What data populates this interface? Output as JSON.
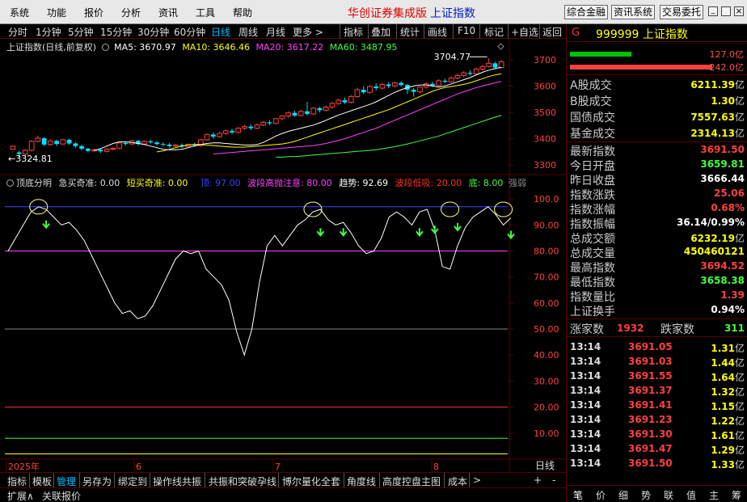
{
  "menu": {
    "items": [
      "系统",
      "功能",
      "报价",
      "分析",
      "资讯",
      "工具",
      "帮助"
    ],
    "title_brand": "华创证券集成版",
    "title_index": "上证指数",
    "right_buttons": [
      "综合金融",
      "资讯系统",
      "交易委托"
    ]
  },
  "toolbar": {
    "periods": [
      "分时",
      "1分钟",
      "5分钟",
      "15分钟",
      "30分钟",
      "60分钟",
      "日线",
      "周线",
      "月线",
      "更多 >"
    ],
    "active": "日线",
    "tools": [
      "指标",
      "叠加",
      "统计",
      "画线",
      "F10",
      "标记",
      "+自选",
      "返回"
    ]
  },
  "main_chart": {
    "title": "上证指数(日线,前复权)",
    "ma": [
      {
        "label": "MA5: 3670.97",
        "color": "#ffffff"
      },
      {
        "label": "MA10: 3646.46",
        "color": "#ffff00"
      },
      {
        "label": "MA20: 3617.22",
        "color": "#ff40ff"
      },
      {
        "label": "MA60: 3487.95",
        "color": "#40ff40"
      }
    ],
    "high_label": "3704.77",
    "low_label": "3324.81",
    "y_ticks": [
      "3700",
      "3600",
      "3500",
      "3400",
      "3300"
    ]
  },
  "osc_chart": {
    "name": "顶底分明",
    "items": [
      {
        "label": "急买奇准: 0.00",
        "color": "#dddddd"
      },
      {
        "label": "短买奇准: 0.00",
        "color": "#ffff00"
      },
      {
        "label": "顶: 97.00",
        "color": "#4040ff"
      },
      {
        "label": "波段高抛注意: 80.00",
        "color": "#ff40ff"
      },
      {
        "label": "趋势: 92.69",
        "color": "#ffffff"
      },
      {
        "label": "波段低吸: 20.00",
        "color": "#ff3030"
      },
      {
        "label": "底: 8.00",
        "color": "#40ff40"
      },
      {
        "label": "强弱",
        "color": "#888888"
      }
    ],
    "y_ticks": [
      "100.0",
      "90.00",
      "80.00",
      "70.00",
      "60.00",
      "50.00",
      "40.00",
      "30.00",
      "20.00",
      "10.00"
    ]
  },
  "x_axis": {
    "labels": [
      "2025年",
      "6",
      "7",
      "8"
    ],
    "period": "日线"
  },
  "chart_data": {
    "type": "line",
    "main": {
      "ylim": [
        3270,
        3730
      ],
      "candles": [
        [
          3360,
          3372,
          3352,
          3348
        ],
        [
          3348,
          3342,
          3354,
          3330
        ],
        [
          3342,
          3356,
          3360,
          3336
        ],
        [
          3356,
          3390,
          3395,
          3352
        ],
        [
          3390,
          3402,
          3412,
          3386
        ],
        [
          3402,
          3378,
          3406,
          3372
        ],
        [
          3378,
          3392,
          3398,
          3374
        ],
        [
          3392,
          3380,
          3396,
          3372
        ],
        [
          3380,
          3396,
          3400,
          3376
        ],
        [
          3396,
          3382,
          3400,
          3376
        ],
        [
          3382,
          3372,
          3388,
          3366
        ],
        [
          3372,
          3362,
          3378,
          3356
        ],
        [
          3362,
          3354,
          3366,
          3348
        ],
        [
          3354,
          3358,
          3362,
          3350
        ],
        [
          3358,
          3352,
          3362,
          3346
        ],
        [
          3352,
          3360,
          3364,
          3348
        ],
        [
          3360,
          3364,
          3368,
          3356
        ],
        [
          3364,
          3384,
          3388,
          3360
        ],
        [
          3384,
          3380,
          3390,
          3374
        ],
        [
          3380,
          3392,
          3396,
          3376
        ],
        [
          3392,
          3380,
          3396,
          3374
        ],
        [
          3380,
          3390,
          3394,
          3376
        ],
        [
          3390,
          3386,
          3396,
          3382
        ],
        [
          3386,
          3380,
          3390,
          3374
        ],
        [
          3380,
          3378,
          3386,
          3372
        ],
        [
          3378,
          3372,
          3384,
          3366
        ],
        [
          3372,
          3376,
          3380,
          3368
        ],
        [
          3376,
          3370,
          3382,
          3364
        ],
        [
          3370,
          3378,
          3382,
          3366
        ],
        [
          3378,
          3374,
          3384,
          3370
        ],
        [
          3374,
          3396,
          3400,
          3370
        ],
        [
          3396,
          3416,
          3420,
          3392
        ],
        [
          3416,
          3408,
          3424,
          3400
        ],
        [
          3408,
          3420,
          3426,
          3404
        ],
        [
          3420,
          3430,
          3436,
          3414
        ],
        [
          3430,
          3424,
          3438,
          3418
        ],
        [
          3424,
          3440,
          3444,
          3420
        ],
        [
          3440,
          3446,
          3452,
          3434
        ],
        [
          3446,
          3440,
          3454,
          3432
        ],
        [
          3440,
          3452,
          3458,
          3436
        ],
        [
          3452,
          3462,
          3468,
          3448
        ],
        [
          3462,
          3458,
          3470,
          3452
        ],
        [
          3458,
          3476,
          3480,
          3454
        ],
        [
          3476,
          3486,
          3490,
          3470
        ],
        [
          3486,
          3498,
          3504,
          3480
        ],
        [
          3498,
          3488,
          3506,
          3484
        ],
        [
          3488,
          3504,
          3510,
          3484
        ],
        [
          3504,
          3494,
          3540,
          3490
        ],
        [
          3494,
          3516,
          3520,
          3490
        ],
        [
          3516,
          3508,
          3522,
          3500
        ],
        [
          3508,
          3520,
          3526,
          3504
        ],
        [
          3520,
          3534,
          3540,
          3514
        ],
        [
          3534,
          3546,
          3552,
          3528
        ],
        [
          3546,
          3538,
          3556,
          3532
        ],
        [
          3538,
          3560,
          3566,
          3534
        ],
        [
          3560,
          3586,
          3594,
          3556
        ],
        [
          3586,
          3576,
          3600,
          3570
        ],
        [
          3576,
          3598,
          3604,
          3570
        ],
        [
          3598,
          3592,
          3610,
          3584
        ],
        [
          3592,
          3606,
          3612,
          3586
        ],
        [
          3606,
          3600,
          3614,
          3592
        ],
        [
          3600,
          3612,
          3616,
          3594
        ],
        [
          3612,
          3604,
          3618,
          3598
        ],
        [
          3604,
          3586,
          3608,
          3570
        ],
        [
          3586,
          3578,
          3592,
          3560
        ],
        [
          3578,
          3596,
          3600,
          3572
        ],
        [
          3596,
          3608,
          3614,
          3590
        ],
        [
          3608,
          3602,
          3616,
          3596
        ],
        [
          3602,
          3620,
          3626,
          3598
        ],
        [
          3620,
          3616,
          3628,
          3610
        ],
        [
          3616,
          3630,
          3636,
          3612
        ],
        [
          3630,
          3640,
          3648,
          3626
        ],
        [
          3640,
          3650,
          3656,
          3634
        ],
        [
          3650,
          3646,
          3660,
          3640
        ],
        [
          3646,
          3664,
          3670,
          3642
        ],
        [
          3664,
          3674,
          3680,
          3658
        ],
        [
          3674,
          3686,
          3704.77,
          3670
        ],
        [
          3686,
          3670,
          3692,
          3664
        ],
        [
          3670,
          3692,
          3698,
          3666
        ]
      ],
      "ma5": [
        3356,
        3362,
        3372,
        3382,
        3388,
        3388,
        3386,
        3382,
        3378,
        3372,
        3366,
        3360,
        3358,
        3358,
        3360,
        3366,
        3372,
        3378,
        3382,
        3384,
        3384,
        3382,
        3380,
        3378,
        3376,
        3376,
        3378,
        3386,
        3398,
        3410,
        3420,
        3428,
        3434,
        3440,
        3446,
        3452,
        3460,
        3470,
        3480,
        3490,
        3498,
        3506,
        3514,
        3522,
        3530,
        3540,
        3552,
        3564,
        3576,
        3586,
        3594,
        3600,
        3604,
        3604,
        3600,
        3596,
        3600,
        3608,
        3616,
        3624,
        3632,
        3642,
        3652,
        3660,
        3666,
        3671
      ],
      "ma10": [
        3350,
        3354,
        3360,
        3366,
        3372,
        3376,
        3378,
        3378,
        3376,
        3374,
        3372,
        3370,
        3368,
        3368,
        3368,
        3370,
        3372,
        3374,
        3376,
        3378,
        3380,
        3384,
        3390,
        3398,
        3406,
        3414,
        3422,
        3430,
        3438,
        3446,
        3454,
        3462,
        3470,
        3478,
        3486,
        3494,
        3502,
        3510,
        3520,
        3530,
        3540,
        3550,
        3560,
        3570,
        3580,
        3588,
        3594,
        3598,
        3602,
        3606,
        3612,
        3620,
        3628,
        3636,
        3642,
        3646.46
      ],
      "ma20": [
        3342,
        3344,
        3346,
        3348,
        3350,
        3352,
        3354,
        3356,
        3358,
        3360,
        3362,
        3364,
        3366,
        3368,
        3370,
        3372,
        3374,
        3378,
        3382,
        3388,
        3394,
        3400,
        3408,
        3416,
        3424,
        3432,
        3440,
        3450,
        3460,
        3470,
        3480,
        3490,
        3500,
        3510,
        3520,
        3530,
        3540,
        3550,
        3560,
        3570,
        3578,
        3586,
        3594,
        3600,
        3606,
        3612,
        3617.22
      ],
      "ma60": [
        3330,
        3330,
        3332,
        3332,
        3334,
        3336,
        3338,
        3340,
        3342,
        3344,
        3346,
        3348,
        3350,
        3352,
        3354,
        3356,
        3358,
        3362,
        3366,
        3370,
        3375,
        3380,
        3386,
        3392,
        3398,
        3404,
        3410,
        3418,
        3426,
        3434,
        3442,
        3450,
        3458,
        3466,
        3474,
        3482,
        3487.95
      ]
    },
    "osc": {
      "ylim": [
        0,
        105
      ],
      "trend": [
        80,
        85,
        90,
        95,
        97,
        96,
        93,
        90,
        91,
        88,
        84,
        78,
        72,
        66,
        60,
        56,
        57,
        54,
        55,
        59,
        65,
        71,
        77,
        80,
        79,
        80,
        73,
        70,
        67,
        61,
        49,
        40,
        50,
        68,
        82,
        86,
        82,
        86,
        90,
        92,
        95,
        96,
        92,
        90,
        91,
        87,
        82,
        79,
        80,
        85,
        93,
        95,
        93,
        90,
        95,
        96,
        88,
        74,
        73,
        82,
        89,
        93,
        95,
        97,
        94,
        90,
        92.69
      ],
      "markers": [
        {
          "x": 4,
          "y": 97,
          "type": "circle"
        },
        {
          "x": 5,
          "y": 93,
          "type": "arrow"
        },
        {
          "x": 40,
          "y": 96,
          "type": "circle"
        },
        {
          "x": 41,
          "y": 90,
          "type": "arrow"
        },
        {
          "x": 44,
          "y": 90,
          "type": "arrow"
        },
        {
          "x": 54,
          "y": 90,
          "type": "arrow"
        },
        {
          "x": 56,
          "y": 91,
          "type": "arrow"
        },
        {
          "x": 58,
          "y": 96,
          "type": "circle"
        },
        {
          "x": 59,
          "y": 92,
          "type": "arrow"
        },
        {
          "x": 65,
          "y": 96,
          "type": "circle"
        },
        {
          "x": 66,
          "y": 89,
          "type": "arrow"
        }
      ],
      "levels": [
        {
          "name": "顶",
          "value": 97,
          "color": "#4040ff"
        },
        {
          "name": "波段高抛注意",
          "value": 80,
          "color": "#ff40ff"
        },
        {
          "name": "中轴",
          "value": 50,
          "color": "#888888"
        },
        {
          "name": "波段低吸",
          "value": 20,
          "color": "#ff3030"
        },
        {
          "name": "底",
          "value": 8,
          "color": "#40ff40"
        },
        {
          "name": "零轴",
          "value": 2,
          "color": "#ffff00"
        }
      ]
    }
  },
  "quote_panel": {
    "flag": "G",
    "code": "999999",
    "name": "上证指数",
    "bar_up": "127.0亿",
    "bar_down": "242.0亿",
    "rows": [
      {
        "label": "A股成交",
        "value": "6211.39",
        "unit": "亿",
        "color": "#ffff00"
      },
      {
        "label": "B股成交",
        "value": "1.30",
        "unit": "亿",
        "color": "#ffff00"
      },
      {
        "label": "国债成交",
        "value": "7557.63",
        "unit": "亿",
        "color": "#ffff00"
      },
      {
        "label": "基金成交",
        "value": "2314.13",
        "unit": "亿",
        "color": "#ffff00"
      },
      {
        "label": "最新指数",
        "value": "3691.50",
        "unit": "",
        "color": "#ff4040"
      },
      {
        "label": "今日开盘",
        "value": "3659.81",
        "unit": "",
        "color": "#40ff40"
      },
      {
        "label": "昨日收盘",
        "value": "3666.44",
        "unit": "",
        "color": "#ffffff"
      },
      {
        "label": "指数涨跌",
        "value": "25.06",
        "unit": "",
        "color": "#ff4040"
      },
      {
        "label": "指数涨幅",
        "value": "0.68%",
        "unit": "",
        "color": "#ff4040"
      },
      {
        "label": "指数振幅",
        "value": "36.14/0.99%",
        "unit": "",
        "color": "#ffffff"
      },
      {
        "label": "总成交额",
        "value": "6232.19",
        "unit": "亿",
        "color": "#ffff00"
      },
      {
        "label": "总成交量",
        "value": "450460121",
        "unit": "",
        "color": "#ffff00"
      },
      {
        "label": "最高指数",
        "value": "3694.52",
        "unit": "",
        "color": "#ff4040"
      },
      {
        "label": "最低指数",
        "value": "3658.38",
        "unit": "",
        "color": "#40ff40"
      },
      {
        "label": "指数量比",
        "value": "1.39",
        "unit": "",
        "color": "#ff4040"
      },
      {
        "label": "上证换手",
        "value": "0.94%",
        "unit": "",
        "color": "#ffffff"
      }
    ],
    "advance_label": "涨家数",
    "advance_value": "1932",
    "decline_label": "跌家数",
    "decline_value": "311",
    "ticks": [
      {
        "time": "13:14",
        "price": "3691.05",
        "vol": "1.31"
      },
      {
        "time": "13:14",
        "price": "3691.03",
        "vol": "1.44"
      },
      {
        "time": "13:14",
        "price": "3691.55",
        "vol": "1.64"
      },
      {
        "time": "13:14",
        "price": "3691.37",
        "vol": "1.32"
      },
      {
        "time": "13:14",
        "price": "3691.41",
        "vol": "1.15"
      },
      {
        "time": "13:14",
        "price": "3691.23",
        "vol": "1.22"
      },
      {
        "time": "13:14",
        "price": "3691.30",
        "vol": "1.61"
      },
      {
        "time": "13:14",
        "price": "3691.47",
        "vol": "1.29"
      },
      {
        "time": "13:14",
        "price": "3691.50",
        "vol": "1.33"
      }
    ],
    "tick_unit": "亿",
    "tabs": [
      "笔",
      "价",
      "细",
      "势",
      "联",
      "值",
      "主",
      "筹"
    ]
  },
  "bottom_tabs": [
    "指标",
    "模板",
    "管理",
    "另存为",
    "绑定到",
    "操作线共振",
    "共振和突破孕线",
    "博尔量化全套",
    "角度线",
    "高度控盘主图",
    "成本",
    ">"
  ],
  "bottom_active": "管理",
  "bottom_right": [
    "+",
    "-"
  ],
  "status": [
    "扩展∧",
    "关联报价"
  ]
}
